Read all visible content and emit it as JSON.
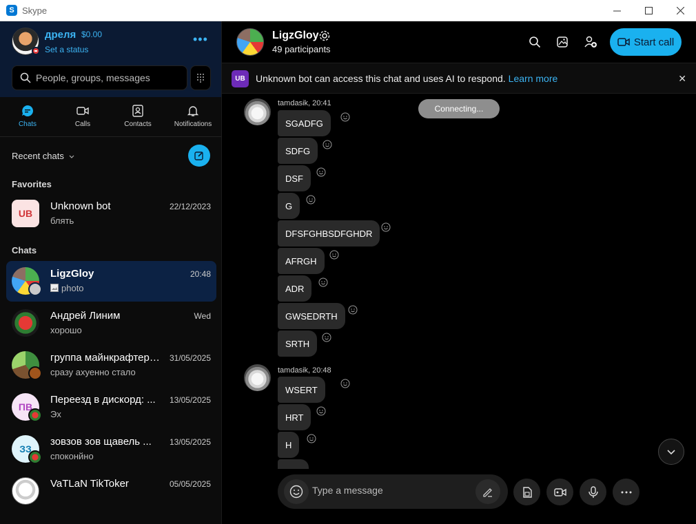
{
  "window": {
    "title": "Skype",
    "icon": "skype-logo-icon"
  },
  "profile": {
    "name": "дреля",
    "balance": "$0.00",
    "status_label": "Set a status",
    "more": "•••"
  },
  "search": {
    "placeholder": "People, groups, messages"
  },
  "nav_tabs": [
    {
      "label": "Chats",
      "icon": "chat-icon",
      "active": true
    },
    {
      "label": "Calls",
      "icon": "video-camera-icon"
    },
    {
      "label": "Contacts",
      "icon": "contacts-icon"
    },
    {
      "label": "Notifications",
      "icon": "bell-icon"
    }
  ],
  "recent_chats_label": "Recent chats",
  "favorites_label": "Favorites",
  "chats_label": "Chats",
  "favorites": [
    {
      "initials": "UB",
      "name": "Unknown bot",
      "preview": "блять",
      "time": "22/12/2023"
    }
  ],
  "chats": [
    {
      "name": "LigzGloy",
      "preview": "photo",
      "time": "20:48",
      "selected": true
    },
    {
      "name": "Андрей Линим",
      "preview": "хорошо",
      "time": "Wed"
    },
    {
      "name": "группа майнкрафтеров",
      "preview": "сразу ахуенно стало",
      "time": "31/05/2025"
    },
    {
      "initials": "ПВ",
      "name": "Переезд в дискорд: ...",
      "preview": "Эх",
      "time": "13/05/2025"
    },
    {
      "initials": "ЗЗ",
      "name": "зовзов зов щавель ...",
      "preview": "споконйно",
      "time": "13/05/2025"
    },
    {
      "name": "VaTLaN TikToker",
      "preview": "",
      "time": "05/05/2025"
    }
  ],
  "conversation": {
    "title": "LigzGloy",
    "participants": "49 participants",
    "start_call": "Start call",
    "banner": {
      "initials": "UB",
      "text": "Unknown bot can access this chat and uses AI to respond.",
      "link": "Learn more",
      "close": "✕"
    },
    "connecting": "Connecting...",
    "groups": [
      {
        "meta": "tamdasik, 20:41",
        "messages": [
          "SGADFG",
          "SDFG",
          "DSF",
          "G",
          "DFSFGHBSDFGHDR",
          "AFRGH",
          "ADR",
          "GWSEDRTH",
          "SRTH"
        ]
      },
      {
        "meta": "tamdasik, 20:48",
        "messages": [
          "WSERT",
          "HRT",
          "H"
        ]
      }
    ],
    "composer_placeholder": "Type a message"
  },
  "colors": {
    "accent": "#1ab1ef",
    "sidebar_top": "#0b1a33",
    "selected_chat": "#0c2244",
    "bubble": "#2a2a2a"
  }
}
